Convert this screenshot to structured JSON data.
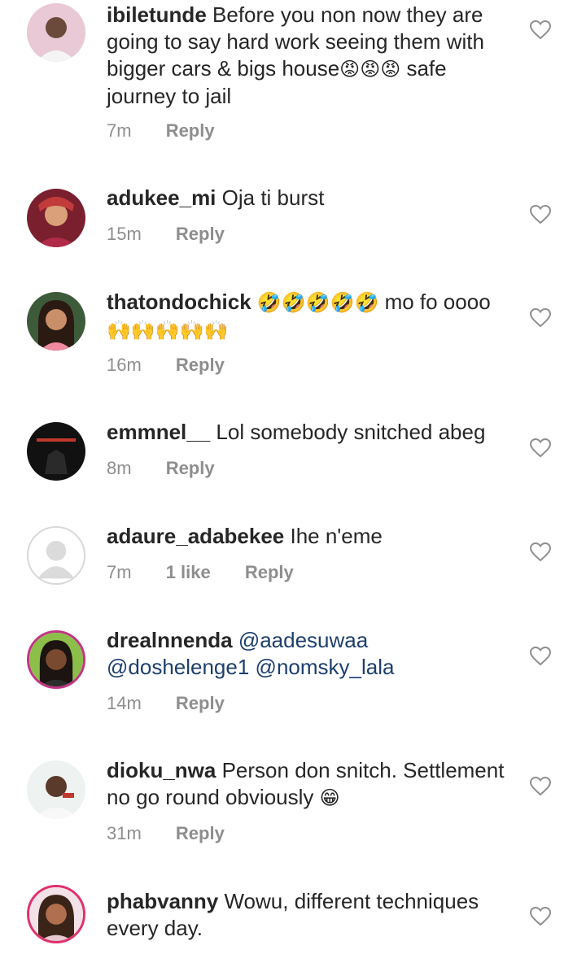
{
  "comments": [
    {
      "username": "ibiletunde",
      "text": "Before you non now they are going to say hard work seeing them with bigger cars & bigs house",
      "emoji": "😡😡😡",
      "text2": "safe journey to jail",
      "time": "7m",
      "reply": "Reply"
    },
    {
      "username": "adukee_mi",
      "text": "Oja ti burst",
      "time": "15m",
      "reply": "Reply"
    },
    {
      "username": "thatondochick",
      "emoji": "🤣🤣🤣🤣🤣",
      "text": "mo fo oooo",
      "emoji2": "🙌🙌🙌🙌🙌",
      "time": "16m",
      "reply": "Reply"
    },
    {
      "username": "emmnel__",
      "text": "Lol somebody snitched abeg",
      "time": "8m",
      "reply": "Reply"
    },
    {
      "username": "adaure_adabekee",
      "text": "Ihe n'eme",
      "time": "7m",
      "likes": "1 like",
      "reply": "Reply"
    },
    {
      "username": "drealnnenda",
      "mention1": "@aadesuwaa",
      "mention2": "@doshelenge1",
      "mention3": "@nomsky_lala",
      "time": "14m",
      "reply": "Reply"
    },
    {
      "username": "dioku_nwa",
      "text": "Person don snitch. Settlement no go round obviously",
      "emoji": "😁",
      "time": "31m",
      "reply": "Reply"
    },
    {
      "username": "phabvanny",
      "text": "Wowu, different techniques every day."
    }
  ],
  "icons": {
    "like": "heart-outline-icon",
    "avatar_default": "default-avatar-icon"
  },
  "colors": {
    "text": "#262626",
    "meta": "#8e8e8e",
    "mention": "#1d3f6e",
    "heart": "#8e8e8e"
  }
}
